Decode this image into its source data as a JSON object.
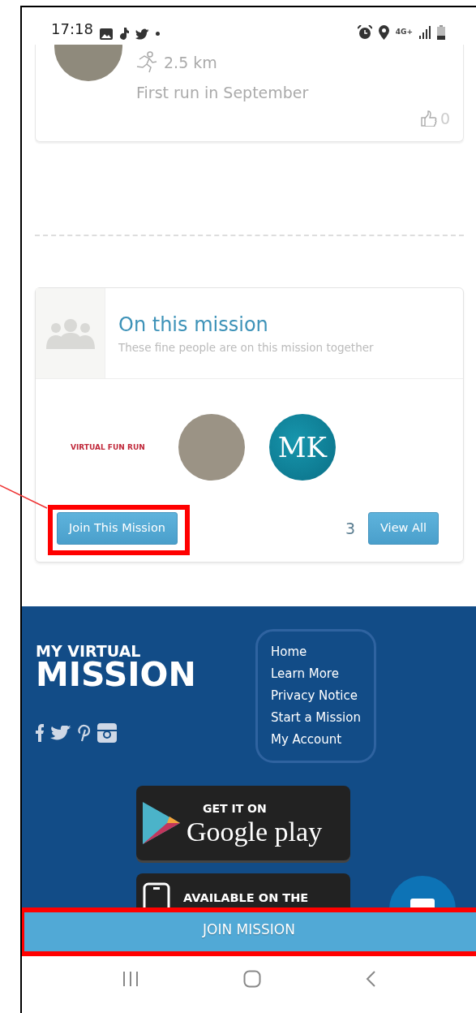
{
  "status_bar": {
    "time": "17:18",
    "network": "4G+"
  },
  "activity": {
    "distance": "2.5 km",
    "title": "First run in September",
    "likes": "0"
  },
  "mission_panel": {
    "title": "On this mission",
    "subtitle": "These fine people are on this mission together",
    "members": [
      {
        "kind": "logo",
        "text": "VIRTUAL FUN RUN"
      },
      {
        "kind": "photo"
      },
      {
        "kind": "initials",
        "text": "MK"
      }
    ],
    "join_button": {
      "label": "Join This Mission",
      "highlighted": true
    },
    "count": "3",
    "view_all": "View All"
  },
  "footer": {
    "logo_top": "MY VIRTUAL",
    "logo_bottom": "MISSION",
    "links": [
      "Home",
      "Learn More",
      "Privacy Notice",
      "Start a Mission",
      "My Account"
    ],
    "badges": [
      {
        "kind": "google",
        "top": "GET IT ON",
        "bottom": "Google play"
      },
      {
        "kind": "apple",
        "top": "AVAILABLE ON THE"
      }
    ]
  },
  "join_bar": {
    "label": "JOIN MISSION",
    "highlighted": true
  }
}
